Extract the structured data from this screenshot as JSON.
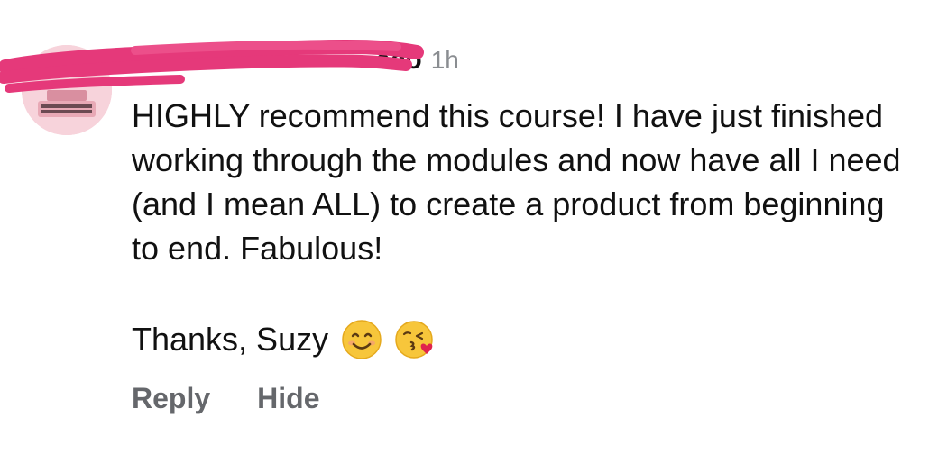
{
  "comment": {
    "author": "eco",
    "time": "1h",
    "body": "HIGHLY recommend this course! I have just finished working through the modules and now have all I need (and I mean ALL) to create a product from beginning to end. Fabulous!",
    "signoff": "Thanks, Suzy",
    "emojis": [
      "smiling-face-with-smiling-eyes",
      "face-blowing-a-kiss"
    ]
  },
  "actions": {
    "reply": "Reply",
    "hide": "Hide"
  },
  "colors": {
    "redaction": "#e5397a",
    "avatar_bg": "#f5c9d3",
    "action_text": "#65676b",
    "timestamp": "#8a8d91"
  }
}
